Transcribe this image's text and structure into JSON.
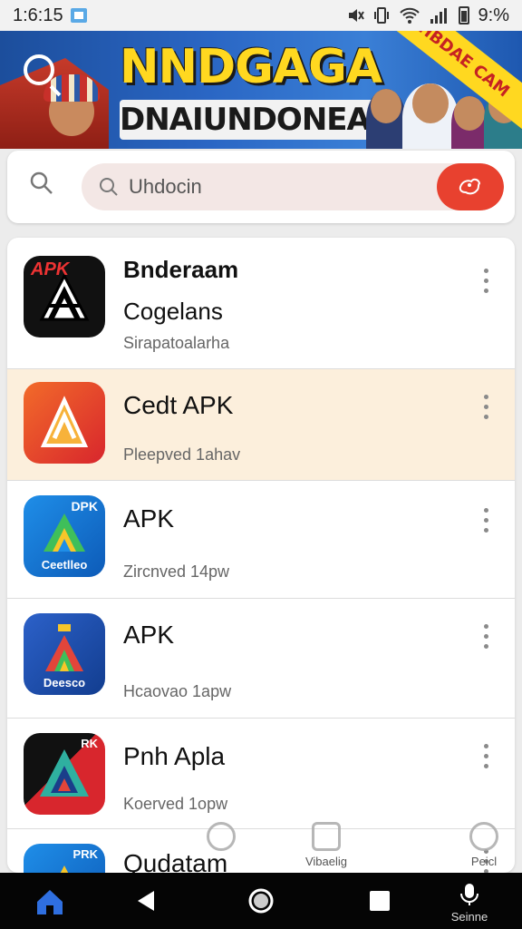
{
  "status_bar": {
    "time": "1:6:15",
    "battery": "9:%"
  },
  "banner": {
    "line1": "NNDGAGA",
    "line2": "DNAIUNDONEAIA",
    "stripe": "BHBDAE CAM"
  },
  "search": {
    "placeholder": "Uhdocin"
  },
  "apps": [
    {
      "title": "Bnderaam",
      "subtitle": "Cogelans",
      "meta": "Sirapatoalarha",
      "icon_label": "APK",
      "icon_bottom": ""
    },
    {
      "title": "Cedt APK",
      "subtitle": "",
      "meta": "Pleepved 1ahav",
      "icon_label": "",
      "icon_bottom": ""
    },
    {
      "title": "APK",
      "subtitle": "",
      "meta": "Zircnved 14pw",
      "icon_label": "DPK",
      "icon_bottom": "Ceetlleo"
    },
    {
      "title": "APK",
      "subtitle": "",
      "meta": "Hcaovao 1apw",
      "icon_label": "",
      "icon_bottom": "Deesco"
    },
    {
      "title": "Pnh Apla",
      "subtitle": "",
      "meta": "Koerved 1opw",
      "icon_label": "RK",
      "icon_bottom": ""
    },
    {
      "title": "Qudatam",
      "subtitle": "",
      "meta": "",
      "icon_label": "PRK",
      "icon_bottom": ""
    }
  ],
  "shortcuts": {
    "middle": "Vibaelig",
    "right": "Peicl"
  },
  "bottom_nav": {
    "mic_label": "Seinne"
  },
  "colors": {
    "accent_red": "#e8412f",
    "highlight_row": "#fcefdc",
    "nav_active": "#2f6fe0"
  }
}
